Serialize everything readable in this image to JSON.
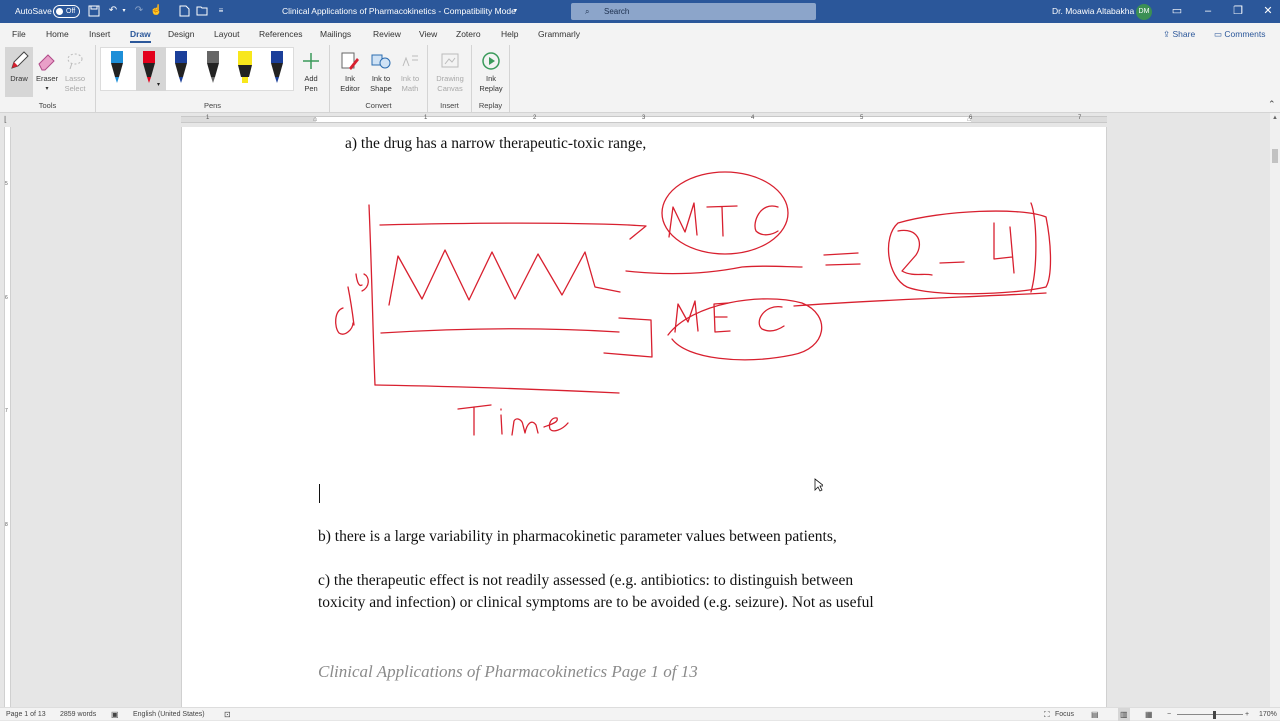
{
  "title_bar": {
    "autosave_label": "AutoSave",
    "autosave_state": "Off",
    "doc_title": "Clinical Applications of Pharmacokinetics  -  Compatibility Mode",
    "search_placeholder": "Search",
    "user_name": "Dr. Moawia Altabakha",
    "user_initials": "DM"
  },
  "menu": {
    "tabs": [
      "File",
      "Home",
      "Insert",
      "Draw",
      "Design",
      "Layout",
      "References",
      "Mailings",
      "Review",
      "View",
      "Zotero",
      "Help",
      "Grammarly"
    ],
    "active_tab": "Draw",
    "share_label": "Share",
    "comments_label": "Comments"
  },
  "ribbon": {
    "tools": {
      "label": "Tools",
      "draw": "Draw",
      "eraser": "Eraser",
      "lasso": "Lasso Select"
    },
    "pens": {
      "label": "Pens",
      "add_pen": "Add Pen",
      "colors": [
        "#1e8fd8",
        "#e3001b",
        "#1b3f9a",
        "#555555",
        "#f8e71c",
        "#1b3f9a"
      ]
    },
    "convert": {
      "label": "Convert",
      "ink_editor": "Ink Editor",
      "ink_to_shape": "Ink to Shape",
      "ink_to_math": "Ink to Math"
    },
    "insert": {
      "label": "Insert",
      "drawing_canvas": "Drawing Canvas"
    },
    "replay": {
      "label": "Replay",
      "ink_replay": "Ink Replay"
    }
  },
  "ruler": {
    "h_numbers": [
      "1",
      "1",
      "2",
      "3",
      "4",
      "5",
      "6",
      "7"
    ],
    "v_numbers": [
      "5",
      "6",
      "7",
      "8"
    ]
  },
  "document": {
    "line_a": "a)   the drug has a narrow therapeutic-toxic range,",
    "line_b": "b) there is a large variability in pharmacokinetic parameter values between patients,",
    "line_c1": "c) the therapeutic effect is not readily assessed (e.g. antibiotics: to distinguish between",
    "line_c2": "toxicity and infection) or clinical symptoms are to be avoided (e.g. seizure). Not as useful",
    "footer": "Clinical Applications of Pharmacokinetics Page 1 of 13"
  },
  "ink": {
    "color": "#d8202f",
    "labels": [
      "MTC",
      "MEC",
      "Cp",
      "Time",
      "2 - 4"
    ]
  },
  "status_bar": {
    "page": "Page 1 of 13",
    "words": "2859 words",
    "language": "English (United States)",
    "focus": "Focus",
    "zoom": "170%"
  },
  "colors": {
    "title_bar": "#2b579a",
    "accent": "#2b579a",
    "avatar": "#3b8f54"
  }
}
